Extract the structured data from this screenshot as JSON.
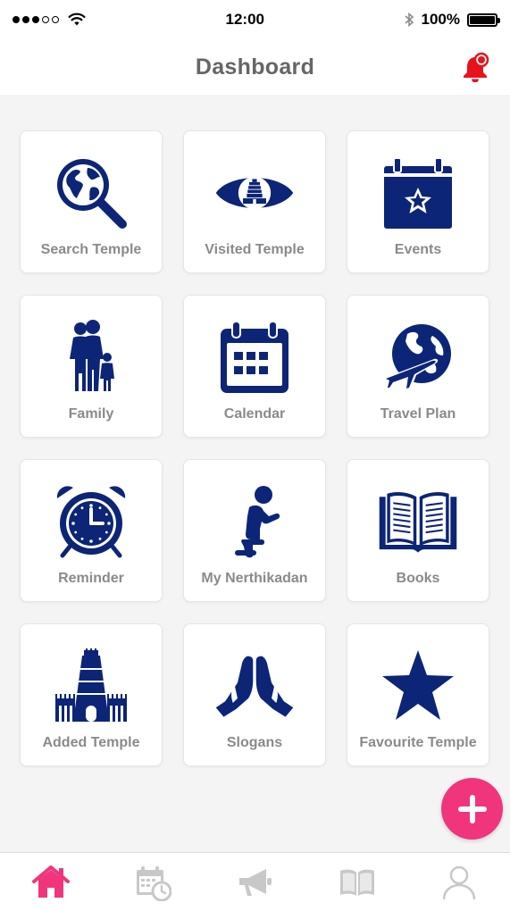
{
  "status_bar": {
    "time": "12:00",
    "battery": "100%",
    "signal_dots_filled": 3,
    "signal_dots_total": 5
  },
  "header": {
    "title": "Dashboard",
    "notification_icon": "bell-icon"
  },
  "tiles": [
    {
      "label": "Search Temple",
      "icon": "globe-search-icon"
    },
    {
      "label": "Visited Temple",
      "icon": "eye-temple-icon"
    },
    {
      "label": "Events",
      "icon": "calendar-star-icon"
    },
    {
      "label": "Family",
      "icon": "family-icon"
    },
    {
      "label": "Calendar",
      "icon": "calendar-icon"
    },
    {
      "label": "Travel Plan",
      "icon": "globe-plane-icon"
    },
    {
      "label": "Reminder",
      "icon": "alarm-clock-icon"
    },
    {
      "label": "My Nerthikadan",
      "icon": "kneeling-person-icon"
    },
    {
      "label": "Books",
      "icon": "open-book-icon"
    },
    {
      "label": "Added Temple",
      "icon": "temple-tower-icon"
    },
    {
      "label": "Slogans",
      "icon": "praying-hands-icon"
    },
    {
      "label": "Favourite Temple",
      "icon": "star-icon"
    }
  ],
  "fab": {
    "icon": "plus-icon"
  },
  "tabbar": {
    "items": [
      {
        "name": "home",
        "icon": "home-icon",
        "active": true
      },
      {
        "name": "schedule",
        "icon": "calendar-clock-icon",
        "active": false
      },
      {
        "name": "announcements",
        "icon": "megaphone-icon",
        "active": false
      },
      {
        "name": "books",
        "icon": "book-icon",
        "active": false
      },
      {
        "name": "profile",
        "icon": "user-icon",
        "active": false
      }
    ]
  },
  "colors": {
    "icon_primary": "#0c2577",
    "accent": "#f0357c",
    "notification": "#e8121d",
    "tab_inactive": "#c8c8c8",
    "label_text": "#8a8a8a",
    "title_text": "#666666"
  }
}
